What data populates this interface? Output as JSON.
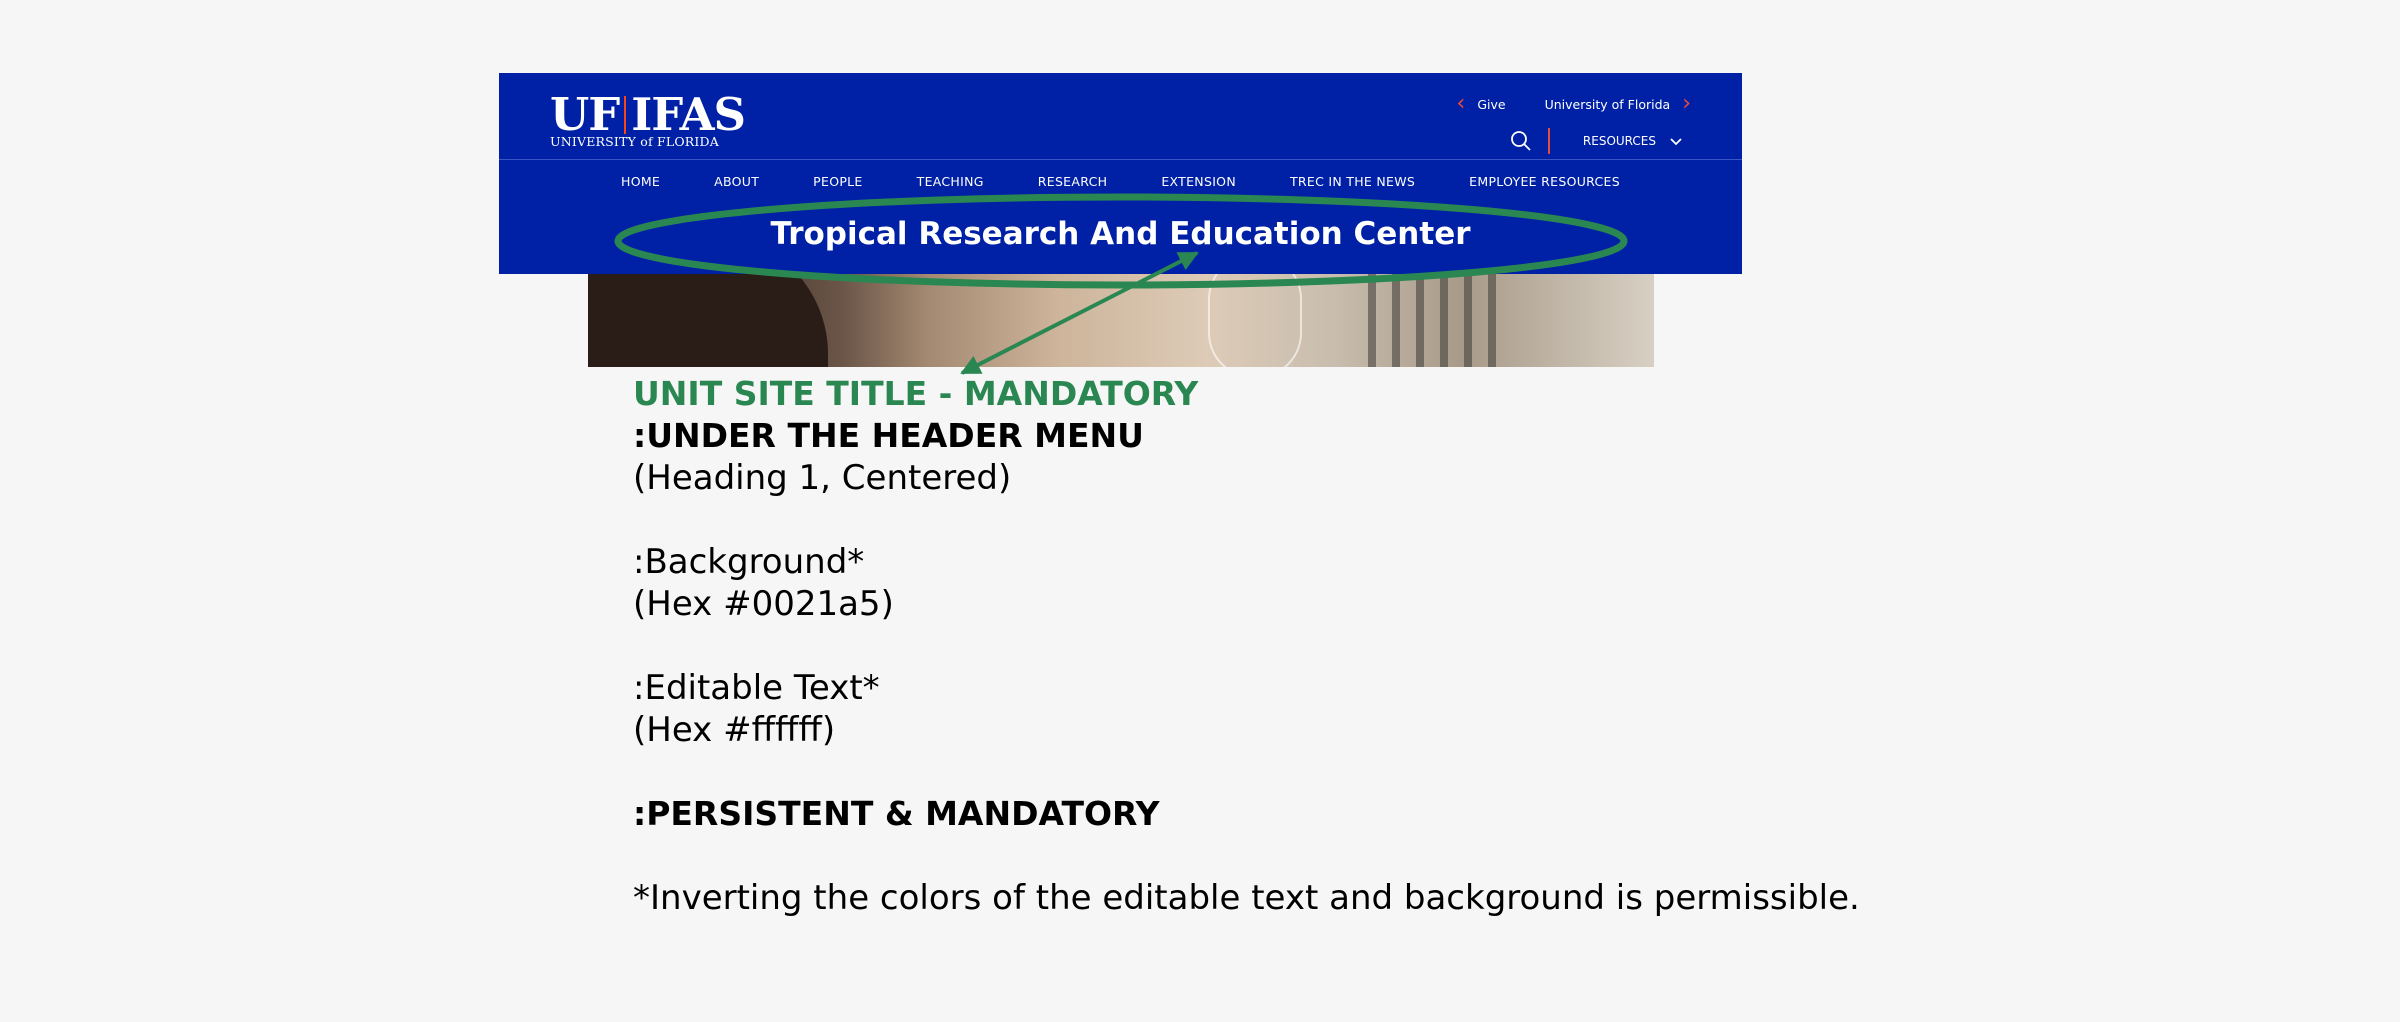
{
  "header": {
    "logo": {
      "main_left": "UF",
      "main_right": "IFAS",
      "sub": "UNIVERSITY of FLORIDA"
    },
    "utility": {
      "give_label": "Give",
      "uf_label": "University of Florida"
    },
    "resources_label": "RESOURCES",
    "nav": [
      "HOME",
      "ABOUT",
      "PEOPLE",
      "TEACHING",
      "RESEARCH",
      "EXTENSION",
      "TREC IN THE NEWS",
      "EMPLOYEE RESOURCES"
    ],
    "site_title": "Tropical Research And Education Center",
    "background_color": "#0021a5",
    "text_color": "#ffffff"
  },
  "annotation": {
    "color": "#2a8752",
    "title": "UNIT SITE TITLE - MANDATORY",
    "subtitle": ":UNDER THE HEADER MENU",
    "format_note": "(Heading 1, Centered)",
    "bg_label": ":Background*",
    "bg_hex": "(Hex #0021a5)",
    "text_label": ":Editable Text*",
    "text_hex": "(Hex #ffffff)",
    "persistent": ":PERSISTENT & MANDATORY",
    "footnote": "*Inverting the colors of the editable text and background is permissible."
  },
  "icons": [
    "chevron-left-icon",
    "chevron-right-icon",
    "search-icon",
    "chevron-down-icon"
  ]
}
